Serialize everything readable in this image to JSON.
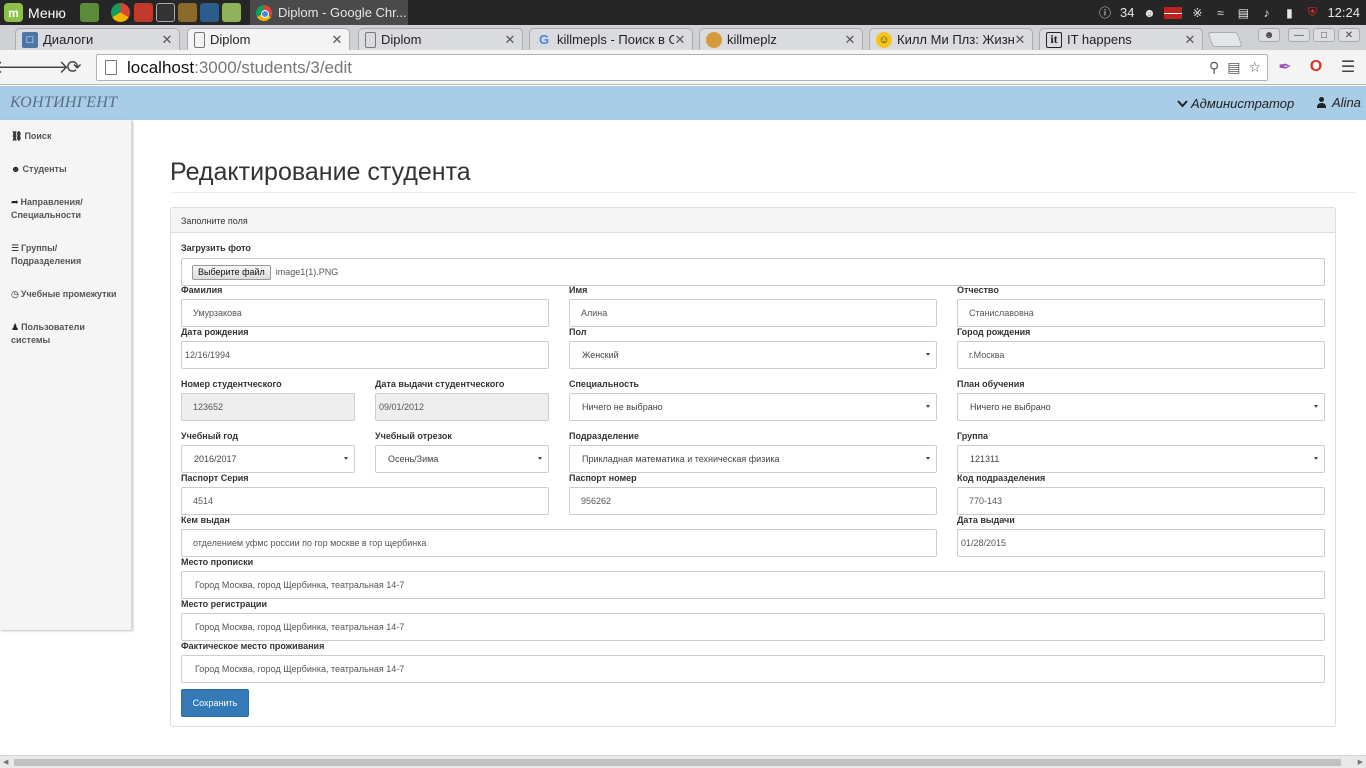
{
  "taskbar": {
    "menu_label": "Меню",
    "active_window_title": "Diplom - Google Chr...",
    "tray_count": "34",
    "clock": "12:24"
  },
  "browser": {
    "tabs": [
      {
        "title": "Диалоги",
        "icon": "speech-bubble-icon"
      },
      {
        "title": "Diplom",
        "icon": "page-icon"
      },
      {
        "title": "Diplom",
        "icon": "page-icon"
      },
      {
        "title": "killmepls - Поиск в G",
        "icon": "google-icon"
      },
      {
        "title": "killmeplz",
        "icon": "pie-icon"
      },
      {
        "title": "Килл Ми Плз: Жизн",
        "icon": "smiley-icon"
      },
      {
        "title": "IT happens",
        "icon": "it-icon"
      }
    ],
    "url_host": "localhost",
    "url_path": ":3000/students/3/edit"
  },
  "app": {
    "brand": "КОНТИНГЕНТ",
    "role_menu": "Администратор",
    "user": "Alina"
  },
  "sidebar": {
    "items": [
      {
        "label": "Поиск",
        "icon": "binoculars-icon"
      },
      {
        "label": "Студенты",
        "icon": "group-icon"
      },
      {
        "label": "Направления/ Специальности",
        "icon": "share-arrow-icon"
      },
      {
        "label": "Группы/ Подразделения",
        "icon": "list-icon"
      },
      {
        "label": "Учебные промежутки",
        "icon": "clock-icon"
      },
      {
        "label": "Пользователи системы",
        "icon": "user-icon"
      }
    ]
  },
  "page": {
    "title": "Редактирование студента",
    "panel_heading": "Заполните поля"
  },
  "form": {
    "photo": {
      "label": "Загрузить фото",
      "button": "Выберите файл",
      "filename": "image1(1).PNG"
    },
    "last_name": {
      "label": "Фамилия",
      "value": "Умурзакова"
    },
    "first_name": {
      "label": "Имя",
      "value": "Алина"
    },
    "patronymic": {
      "label": "Отчество",
      "value": "Станиславовна"
    },
    "birth_date": {
      "label": "Дата рождения",
      "value": "12/16/1994"
    },
    "gender": {
      "label": "Пол",
      "value": "Женский"
    },
    "birth_city": {
      "label": "Город рождения",
      "value": "г.Москва"
    },
    "student_card": {
      "label": "Номер студентческого",
      "value": "123652"
    },
    "student_card_date": {
      "label": "Дата выдачи студентческого",
      "value": "09/01/2012"
    },
    "specialty": {
      "label": "Специальность",
      "value": "Ничего не выбрано"
    },
    "study_plan": {
      "label": "План обучения",
      "value": "Ничего не выбрано"
    },
    "study_year": {
      "label": "Учебный год",
      "value": "2016/2017"
    },
    "study_term": {
      "label": "Учебный отрезок",
      "value": "Осень/Зима"
    },
    "department": {
      "label": "Подразделение",
      "value": "Прикладная математика и техническая физика"
    },
    "group": {
      "label": "Группа",
      "value": "121311"
    },
    "passport_series": {
      "label": "Паспорт Серия",
      "value": "4514"
    },
    "passport_number": {
      "label": "Паспорт номер",
      "value": "956262"
    },
    "division_code": {
      "label": "Код подразделения",
      "value": "770-143"
    },
    "issued_by": {
      "label": "Кем выдан",
      "value": "отделением уфмс россии по гор москве в гор щербинка"
    },
    "issue_date": {
      "label": "Дата выдачи",
      "value": "01/28/2015"
    },
    "residence": {
      "label": "Место прописки",
      "value": "Город Москва, город Щербинка, театральная 14-7"
    },
    "registration": {
      "label": "Место регистрации",
      "value": "Город Москва, город Щербинка, театральная 14-7"
    },
    "actual_address": {
      "label": "Фактическое место проживания",
      "value": "Город Москва, город Щербинка, театральная 14-7"
    },
    "submit": "Сохранить"
  },
  "colors": {
    "navbar": "#a9cce7",
    "primary_button": "#337ab7",
    "taskbar": "#262626"
  }
}
